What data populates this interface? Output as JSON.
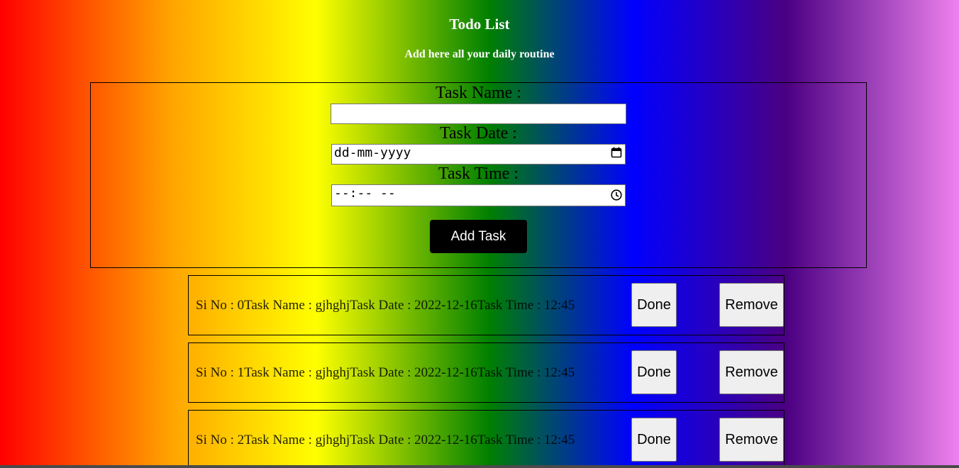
{
  "header": {
    "title": "Todo List",
    "subtitle": "Add here all your daily routine"
  },
  "form": {
    "task_name_label": "Task Name :",
    "task_name_value": "",
    "task_date_label": "Task Date :",
    "task_date_placeholder": "dd-mm-yyyy",
    "task_time_label": "Task Time :",
    "task_time_placeholder": "--:-- --",
    "add_button_label": "Add Task"
  },
  "tasks": [
    {
      "text": "Si No : 0Task Name : gjhghjTask Date : 2022-12-16Task Time : 12:45",
      "done_label": "Done",
      "remove_label": "Remove"
    },
    {
      "text": "Si No : 1Task Name : gjhghjTask Date : 2022-12-16Task Time : 12:45",
      "done_label": "Done",
      "remove_label": "Remove"
    },
    {
      "text": "Si No : 2Task Name : gjhghjTask Date : 2022-12-16Task Time : 12:45",
      "done_label": "Done",
      "remove_label": "Remove"
    }
  ],
  "icons": {
    "date": "calendar-icon",
    "time": "clock-icon"
  },
  "colors": {
    "gradient": [
      "#ff0000",
      "#ffa500",
      "#ffff00",
      "#008000",
      "#0000ff",
      "#4b0082",
      "#ee82ee"
    ],
    "button_bg": "#000000",
    "button_text": "#ffffff"
  }
}
